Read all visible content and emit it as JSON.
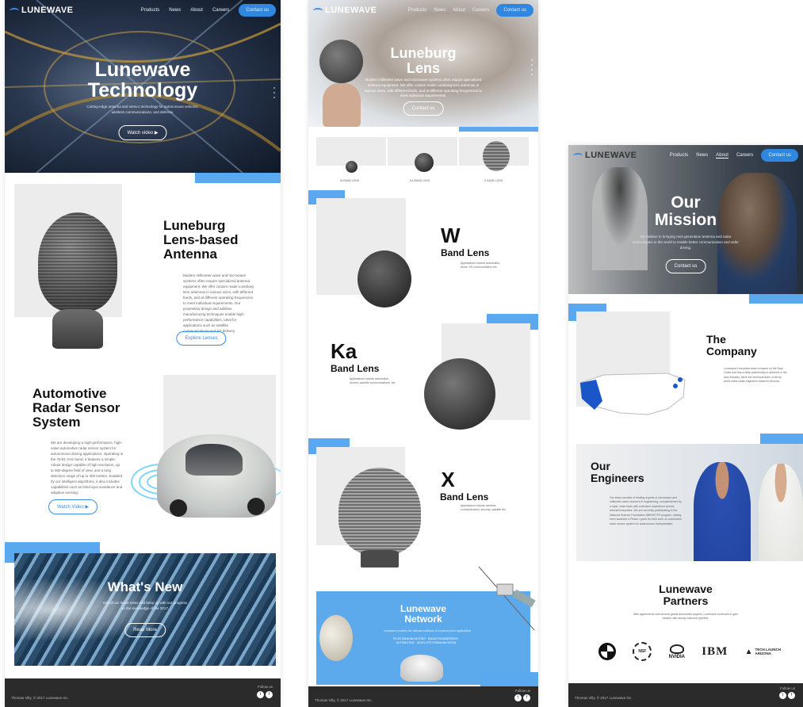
{
  "brand": {
    "logo": "LUNEWAVE",
    "accent": "#59a8f0",
    "button": "#2f87e0"
  },
  "nav": {
    "products": "Products",
    "news": "News",
    "about": "About",
    "careers": "Careers",
    "contact": "Contact us"
  },
  "page1": {
    "hero_title_1": "Lunewave",
    "hero_title_2": "Technology",
    "hero_text": "Cutting-edge antenna and sensor technology for autonomous vehicles, wireless communications, and defense.",
    "hero_button": "Watch video",
    "s1_title_1": "Luneburg",
    "s1_title_2": "Lens-based",
    "s1_title_3": "Antenna",
    "s1_text": "Modern millimeter wave and microwave systems often require specialized antenna equipment. We offer custom made Luneburg lens antennas in various sizes, with different feeds, and at different operating frequencies to meet individual requirements. Our proprietary design and additive manufacturing techniques enable high-performance capabilities, ideal for applications such as satellite communications and 5G delivery.",
    "s1_button": "Explore Lenses",
    "s2_title_1": "Automotive",
    "s2_title_2": "Radar Sensor",
    "s2_title_3": "System",
    "s2_text": "We are developing a high-performance, high-value automotive radar sensor system for autonomous driving applications. Operating in the 76-81 GHz band, it features a simple, robust design capable of high resolution, up to 360-degree field of view, and a long detection range of up to 300 meters. Enabled by our intelligent algorithms, it also includes capabilities such as blind-spot avoidance and adaptive sensing.",
    "s2_button": "Watch Video",
    "news_title": "What's New",
    "news_text": "Get all our latest news and keep up with our progress on the knowledge of the 2017.",
    "news_button": "Read More",
    "footer_copy": "Thomas Villy, © 2017 Lunewave Inc.",
    "follow": "Follow us"
  },
  "page2": {
    "hero_title_1": "Luneburg",
    "hero_title_2": "Lens",
    "hero_text": "Modern millimeter wave and microwave systems often require specialized antenna equipment. We offer custom made Luneburg lens antennas in various sizes, with different feeds, and at different operating frequencies to meet individual requirements.",
    "hero_button": "Contact us",
    "thumb1": "W BAND LENS",
    "thumb2": "KA BAND LENS",
    "thumb3": "X BAND LENS",
    "w_big": "W",
    "w_sub": "Band Lens",
    "w_text": "Applications include automotive, drone, 5G communication etc.",
    "ka_big": "Ka",
    "ka_sub": "Band Lens",
    "ka_text": "Applications include automotive, drones, satellite communications, etc.",
    "x_big": "X",
    "x_sub": "Band Lens",
    "x_text": "Applications include wireless communication, security, satellite etc.",
    "net_title_1": "Lunewave",
    "net_title_2": "Network",
    "net_text": "Lunewave provides the ultimate solutions of Luneburg lens applications",
    "net_links": "TELECOMMUNICATIONS · RADAR ENGINEERING · AUTOMOTIVE · SATELLITE COMMUNICATION",
    "footer_copy": "Thomas Villy, © 2017 Lunewave Inc.",
    "follow": "Follow us"
  },
  "page3": {
    "hero_title_1": "Our",
    "hero_title_2": "Mission",
    "hero_text": "We believe in bringing next-generation antenna and radar technologies to the world to enable better communication and safer driving.",
    "hero_button": "Contact us",
    "company_1": "The",
    "company_2": "Company",
    "company_text": "Lunewave's business team is based on the East Coast and has a deep partnership in antenna in the auto industry, while the technical team is led by world-class radar engineers based in Arizona.",
    "eng_1": "Our",
    "eng_2": "Engineers",
    "eng_text": "Our team consists of leading experts in microwave and millimeter wave research & engineering, complemented by a loyal, close team with extensive experience across relevant industries. We are currently participating in the National Science Foundation SBIR/STTR program, having been awarded a Phase I grant for their work on automotive radar sensor system for autonomous transportation.",
    "partners_1": "Lunewave",
    "partners_2": "Partners",
    "partners_text": "With agreements with several global automotive players, Lunewave continues to gain traction with strong customer pipeline.",
    "p_nsf": "NSF",
    "p_nvidia": "NVIDIA",
    "p_ibm": "IBM",
    "p_tech": "TECH LAUNCH",
    "p_arizona": "ARIZONA",
    "footer_copy": "Thomas Villy, © 2017 Lunewave Inc.",
    "follow": "Follow us"
  }
}
